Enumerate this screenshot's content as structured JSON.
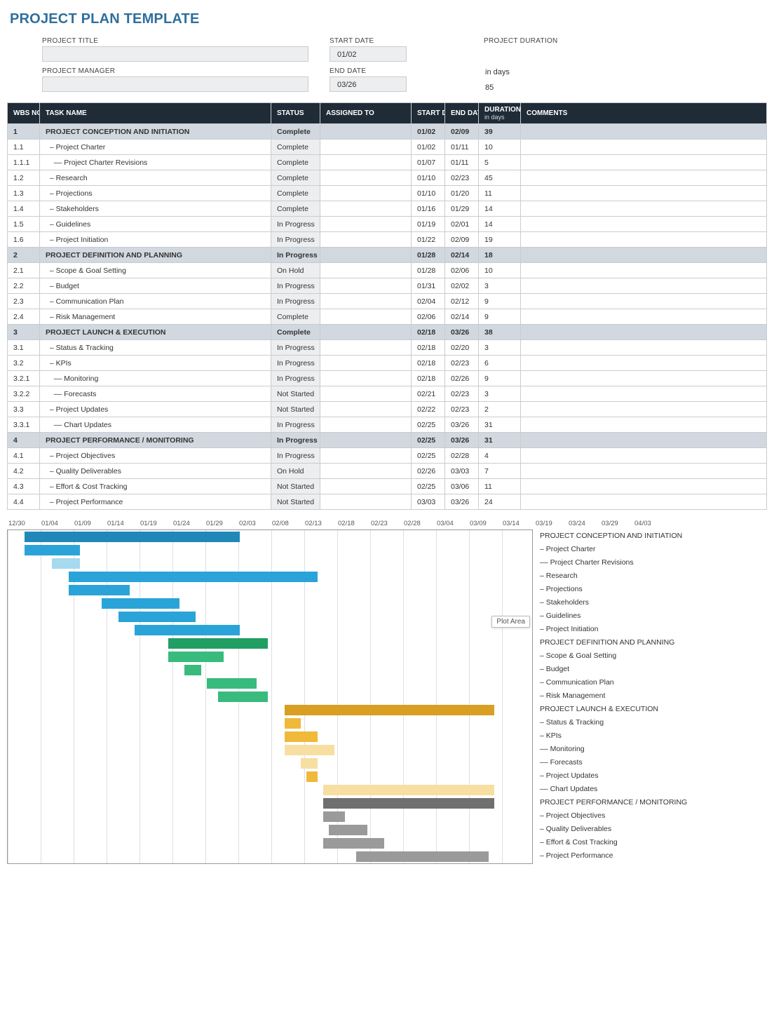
{
  "page_title": "PROJECT PLAN TEMPLATE",
  "header": {
    "project_title_label": "PROJECT TITLE",
    "project_title_value": "",
    "project_manager_label": "PROJECT MANAGER",
    "project_manager_value": "",
    "start_date_label": "START DATE",
    "start_date_value": "01/02",
    "end_date_label": "END DATE",
    "end_date_value": "03/26",
    "project_duration_label": "PROJECT DURATION",
    "project_duration_unit": "in days",
    "project_duration_value": "85"
  },
  "columns": {
    "wbs": "WBS NO.",
    "task": "TASK NAME",
    "status": "STATUS",
    "assigned": "ASSIGNED TO",
    "start": "START DATE",
    "end": "END DATE",
    "duration": "DURATION",
    "duration_sub": "in days",
    "comments": "COMMENTS"
  },
  "rows": [
    {
      "wbs": "1",
      "task": "PROJECT CONCEPTION AND INITIATION",
      "status": "Complete",
      "assigned": "",
      "start": "01/02",
      "end": "02/09",
      "duration": "39",
      "comments": "",
      "group": true,
      "section": 1
    },
    {
      "wbs": "1.1",
      "task": "– Project Charter",
      "status": "Complete",
      "assigned": "",
      "start": "01/02",
      "end": "01/11",
      "duration": "10",
      "comments": "",
      "indent": 1,
      "section": 1
    },
    {
      "wbs": "1.1.1",
      "task": "–– Project Charter Revisions",
      "status": "Complete",
      "assigned": "",
      "start": "01/07",
      "end": "01/11",
      "duration": "5",
      "comments": "",
      "indent": 2,
      "section": 1
    },
    {
      "wbs": "1.2",
      "task": "– Research",
      "status": "Complete",
      "assigned": "",
      "start": "01/10",
      "end": "02/23",
      "duration": "45",
      "comments": "",
      "indent": 1,
      "section": 1
    },
    {
      "wbs": "1.3",
      "task": "– Projections",
      "status": "Complete",
      "assigned": "",
      "start": "01/10",
      "end": "01/20",
      "duration": "11",
      "comments": "",
      "indent": 1,
      "section": 1
    },
    {
      "wbs": "1.4",
      "task": "– Stakeholders",
      "status": "Complete",
      "assigned": "",
      "start": "01/16",
      "end": "01/29",
      "duration": "14",
      "comments": "",
      "indent": 1,
      "section": 1
    },
    {
      "wbs": "1.5",
      "task": "– Guidelines",
      "status": "In Progress",
      "assigned": "",
      "start": "01/19",
      "end": "02/01",
      "duration": "14",
      "comments": "",
      "indent": 1,
      "section": 1
    },
    {
      "wbs": "1.6",
      "task": "– Project Initiation",
      "status": "In Progress",
      "assigned": "",
      "start": "01/22",
      "end": "02/09",
      "duration": "19",
      "comments": "",
      "indent": 1,
      "section": 1
    },
    {
      "wbs": "2",
      "task": "PROJECT DEFINITION AND PLANNING",
      "status": "In Progress",
      "assigned": "",
      "start": "01/28",
      "end": "02/14",
      "duration": "18",
      "comments": "",
      "group": true,
      "section": 2
    },
    {
      "wbs": "2.1",
      "task": "– Scope & Goal Setting",
      "status": "On Hold",
      "assigned": "",
      "start": "01/28",
      "end": "02/06",
      "duration": "10",
      "comments": "",
      "indent": 1,
      "section": 2
    },
    {
      "wbs": "2.2",
      "task": "– Budget",
      "status": "In Progress",
      "assigned": "",
      "start": "01/31",
      "end": "02/02",
      "duration": "3",
      "comments": "",
      "indent": 1,
      "section": 2
    },
    {
      "wbs": "2.3",
      "task": "– Communication Plan",
      "status": "In Progress",
      "assigned": "",
      "start": "02/04",
      "end": "02/12",
      "duration": "9",
      "comments": "",
      "indent": 1,
      "section": 2
    },
    {
      "wbs": "2.4",
      "task": "– Risk Management",
      "status": "Complete",
      "assigned": "",
      "start": "02/06",
      "end": "02/14",
      "duration": "9",
      "comments": "",
      "indent": 1,
      "section": 2
    },
    {
      "wbs": "3",
      "task": "PROJECT LAUNCH & EXECUTION",
      "status": "Complete",
      "assigned": "",
      "start": "02/18",
      "end": "03/26",
      "duration": "38",
      "comments": "",
      "group": true,
      "section": 3
    },
    {
      "wbs": "3.1",
      "task": "– Status & Tracking",
      "status": "In Progress",
      "assigned": "",
      "start": "02/18",
      "end": "02/20",
      "duration": "3",
      "comments": "",
      "indent": 1,
      "section": 3
    },
    {
      "wbs": "3.2",
      "task": "– KPIs",
      "status": "In Progress",
      "assigned": "",
      "start": "02/18",
      "end": "02/23",
      "duration": "6",
      "comments": "",
      "indent": 1,
      "section": 3
    },
    {
      "wbs": "3.2.1",
      "task": "–– Monitoring",
      "status": "In Progress",
      "assigned": "",
      "start": "02/18",
      "end": "02/26",
      "duration": "9",
      "comments": "",
      "indent": 2,
      "section": 3
    },
    {
      "wbs": "3.2.2",
      "task": "–– Forecasts",
      "status": "Not Started",
      "assigned": "",
      "start": "02/21",
      "end": "02/23",
      "duration": "3",
      "comments": "",
      "indent": 2,
      "section": 3
    },
    {
      "wbs": "3.3",
      "task": "– Project Updates",
      "status": "Not Started",
      "assigned": "",
      "start": "02/22",
      "end": "02/23",
      "duration": "2",
      "comments": "",
      "indent": 1,
      "section": 3
    },
    {
      "wbs": "3.3.1",
      "task": "–– Chart Updates",
      "status": "In Progress",
      "assigned": "",
      "start": "02/25",
      "end": "03/26",
      "duration": "31",
      "comments": "",
      "indent": 2,
      "section": 3
    },
    {
      "wbs": "4",
      "task": "PROJECT PERFORMANCE / MONITORING",
      "status": "In Progress",
      "assigned": "",
      "start": "02/25",
      "end": "03/26",
      "duration": "31",
      "comments": "",
      "group": true,
      "section": 4
    },
    {
      "wbs": "4.1",
      "task": "– Project Objectives",
      "status": "In Progress",
      "assigned": "",
      "start": "02/25",
      "end": "02/28",
      "duration": "4",
      "comments": "",
      "indent": 1,
      "section": 4
    },
    {
      "wbs": "4.2",
      "task": "– Quality Deliverables",
      "status": "On Hold",
      "assigned": "",
      "start": "02/26",
      "end": "03/03",
      "duration": "7",
      "comments": "",
      "indent": 1,
      "section": 4
    },
    {
      "wbs": "4.3",
      "task": "– Effort & Cost Tracking",
      "status": "Not Started",
      "assigned": "",
      "start": "02/25",
      "end": "03/06",
      "duration": "11",
      "comments": "",
      "indent": 1,
      "section": 4
    },
    {
      "wbs": "4.4",
      "task": "– Project Performance",
      "status": "Not Started",
      "assigned": "",
      "start": "03/03",
      "end": "03/26",
      "duration": "24",
      "comments": "",
      "indent": 1,
      "section": 4
    }
  ],
  "chart_data": {
    "type": "bar",
    "orientation": "horizontal-gantt",
    "time_origin": "12/30",
    "axis_ticks": [
      "12/30",
      "01/04",
      "01/09",
      "01/14",
      "01/19",
      "01/24",
      "01/29",
      "02/03",
      "02/08",
      "02/13",
      "02/18",
      "02/23",
      "02/28",
      "03/04",
      "03/09",
      "03/14",
      "03/19",
      "03/24",
      "03/29",
      "04/03"
    ],
    "pixels_per_day": 7.89,
    "legend_tooltip": "Plot Area",
    "series": [
      {
        "name": "PROJECT CONCEPTION AND INITIATION",
        "start_offset_days": 3,
        "duration_days": 39,
        "section": 1,
        "level": 0
      },
      {
        "name": "– Project Charter",
        "start_offset_days": 3,
        "duration_days": 10,
        "section": 1,
        "level": 1
      },
      {
        "name": "–– Project Charter Revisions",
        "start_offset_days": 8,
        "duration_days": 5,
        "section": 1,
        "level": 2
      },
      {
        "name": "– Research",
        "start_offset_days": 11,
        "duration_days": 45,
        "section": 1,
        "level": 1
      },
      {
        "name": "– Projections",
        "start_offset_days": 11,
        "duration_days": 11,
        "section": 1,
        "level": 1
      },
      {
        "name": "– Stakeholders",
        "start_offset_days": 17,
        "duration_days": 14,
        "section": 1,
        "level": 1
      },
      {
        "name": "– Guidelines",
        "start_offset_days": 20,
        "duration_days": 14,
        "section": 1,
        "level": 1
      },
      {
        "name": "– Project Initiation",
        "start_offset_days": 23,
        "duration_days": 19,
        "section": 1,
        "level": 1
      },
      {
        "name": "PROJECT DEFINITION AND PLANNING",
        "start_offset_days": 29,
        "duration_days": 18,
        "section": 2,
        "level": 0
      },
      {
        "name": "– Scope & Goal Setting",
        "start_offset_days": 29,
        "duration_days": 10,
        "section": 2,
        "level": 1
      },
      {
        "name": "– Budget",
        "start_offset_days": 32,
        "duration_days": 3,
        "section": 2,
        "level": 1
      },
      {
        "name": "– Communication Plan",
        "start_offset_days": 36,
        "duration_days": 9,
        "section": 2,
        "level": 1
      },
      {
        "name": "– Risk Management",
        "start_offset_days": 38,
        "duration_days": 9,
        "section": 2,
        "level": 1
      },
      {
        "name": "PROJECT LAUNCH & EXECUTION",
        "start_offset_days": 50,
        "duration_days": 38,
        "section": 3,
        "level": 0
      },
      {
        "name": "– Status & Tracking",
        "start_offset_days": 50,
        "duration_days": 3,
        "section": 3,
        "level": 1
      },
      {
        "name": "– KPIs",
        "start_offset_days": 50,
        "duration_days": 6,
        "section": 3,
        "level": 1
      },
      {
        "name": "–– Monitoring",
        "start_offset_days": 50,
        "duration_days": 9,
        "section": 3,
        "level": 2
      },
      {
        "name": "–– Forecasts",
        "start_offset_days": 53,
        "duration_days": 3,
        "section": 3,
        "level": 2
      },
      {
        "name": "– Project Updates",
        "start_offset_days": 54,
        "duration_days": 2,
        "section": 3,
        "level": 1
      },
      {
        "name": "–– Chart Updates",
        "start_offset_days": 57,
        "duration_days": 31,
        "section": 3,
        "level": 2
      },
      {
        "name": "PROJECT PERFORMANCE / MONITORING",
        "start_offset_days": 57,
        "duration_days": 31,
        "section": 4,
        "level": 0
      },
      {
        "name": "– Project Objectives",
        "start_offset_days": 57,
        "duration_days": 4,
        "section": 4,
        "level": 1
      },
      {
        "name": "– Quality Deliverables",
        "start_offset_days": 58,
        "duration_days": 7,
        "section": 4,
        "level": 1
      },
      {
        "name": "– Effort & Cost Tracking",
        "start_offset_days": 57,
        "duration_days": 11,
        "section": 4,
        "level": 1
      },
      {
        "name": "– Project Performance",
        "start_offset_days": 63,
        "duration_days": 24,
        "section": 4,
        "level": 1
      }
    ],
    "section_colors": {
      "1": {
        "dark": "#1f88b8",
        "mid": "#2aa4d8",
        "light": "#a7d9ef"
      },
      "2": {
        "dark": "#219e62",
        "mid": "#38bb7d",
        "light": "#a8e3c4"
      },
      "3": {
        "dark": "#d89f22",
        "mid": "#f0b93a",
        "light": "#f7dfa2"
      },
      "4": {
        "dark": "#6f6f6f",
        "mid": "#9a9a9a",
        "light": "#cccccc"
      }
    }
  }
}
